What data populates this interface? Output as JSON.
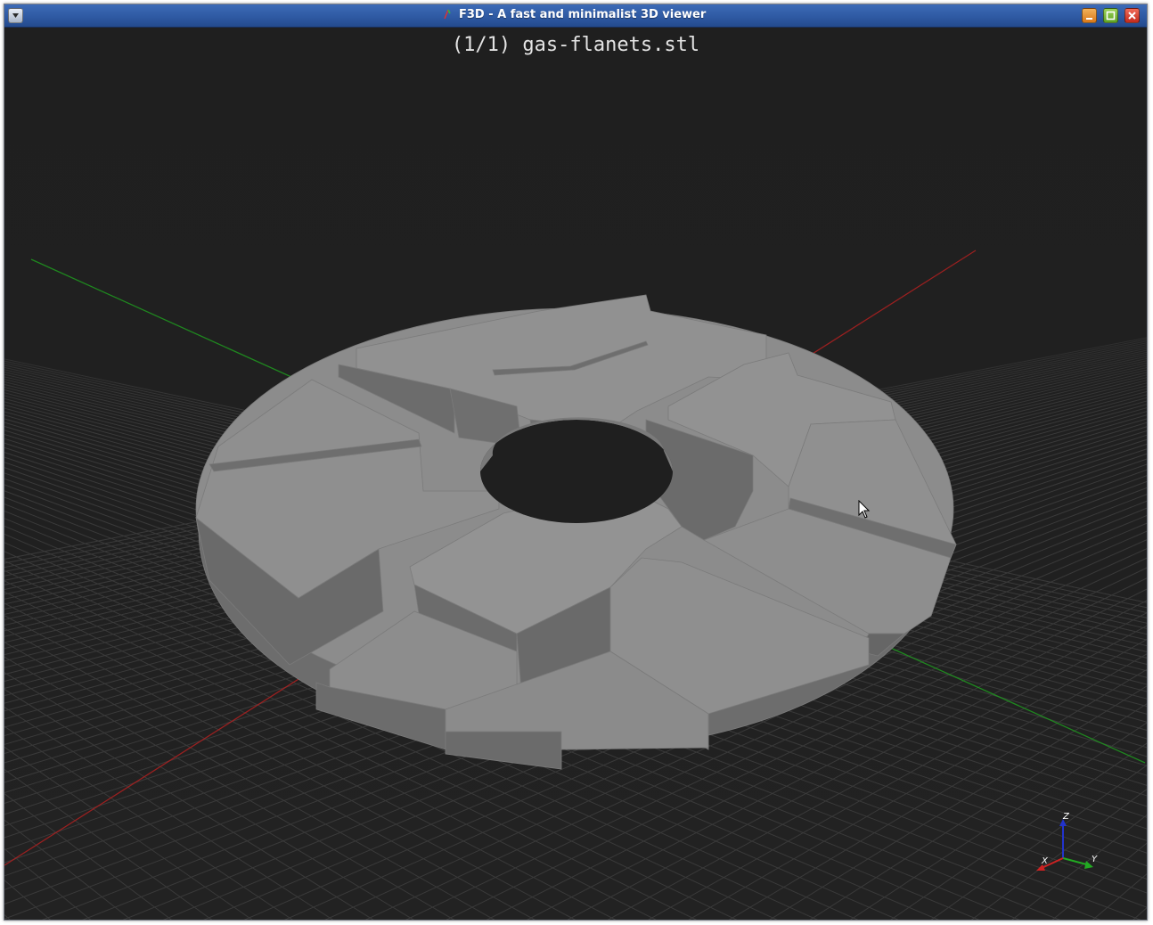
{
  "window": {
    "title": "F3D - A fast and minimalist 3D viewer"
  },
  "viewer": {
    "file_label": "(1/1) gas-flanets.stl",
    "model_color": "#8f8f8f",
    "background_color": "#1f1f1f",
    "grid_color": "#3a3a3a",
    "x_axis_color": "#cc2222",
    "y_axis_color": "#22aa22",
    "z_axis_color": "#2233cc"
  },
  "orientation_axes": {
    "x_label": "X",
    "y_label": "Y",
    "z_label": "Z"
  },
  "icons": {
    "menu": "window-menu-icon",
    "minimize": "minimize-icon",
    "maximize": "maximize-icon",
    "close": "close-icon",
    "cursor": "mouse-cursor-icon"
  }
}
